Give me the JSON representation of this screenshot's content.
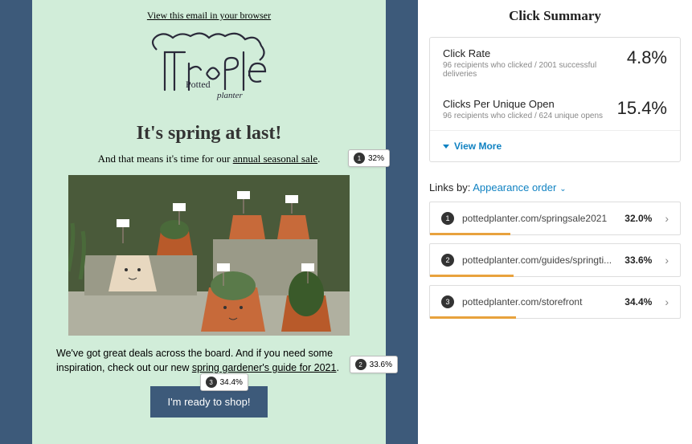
{
  "email": {
    "view_browser": "View this email in your browser",
    "headline": "It's spring at last!",
    "subline_prefix": "And that means it's time for our ",
    "subline_link": "annual seasonal sale",
    "subline_suffix": ".",
    "body_prefix": "We've got great deals across the board. And if you need some inspiration, check out our new ",
    "body_link": "spring gardener's guide for 2021",
    "body_suffix": ".",
    "cta": "I'm ready to shop!",
    "badges": {
      "b1_num": "1",
      "b1_pct": "32%",
      "b2_num": "2",
      "b2_pct": "33.6%",
      "b3_num": "3",
      "b3_pct": "34.4%"
    }
  },
  "summary": {
    "title": "Click Summary",
    "metric1_label": "Click Rate",
    "metric1_sub": "96 recipients who clicked / 2001 successful deliveries",
    "metric1_val": "4.8%",
    "metric2_label": "Clicks Per Unique Open",
    "metric2_sub": "96 recipients who clicked / 624 unique opens",
    "metric2_val": "15.4%",
    "view_more": "View More"
  },
  "links": {
    "label": "Links by:",
    "sort": "Appearance order",
    "rows": [
      {
        "num": "1",
        "url": "pottedplanter.com/springsale2021",
        "pct": "32.0%",
        "bar": 32
      },
      {
        "num": "2",
        "url": "pottedplanter.com/guides/springti...",
        "pct": "33.6%",
        "bar": 33.6
      },
      {
        "num": "3",
        "url": "pottedplanter.com/storefront",
        "pct": "34.4%",
        "bar": 34.4
      }
    ]
  }
}
